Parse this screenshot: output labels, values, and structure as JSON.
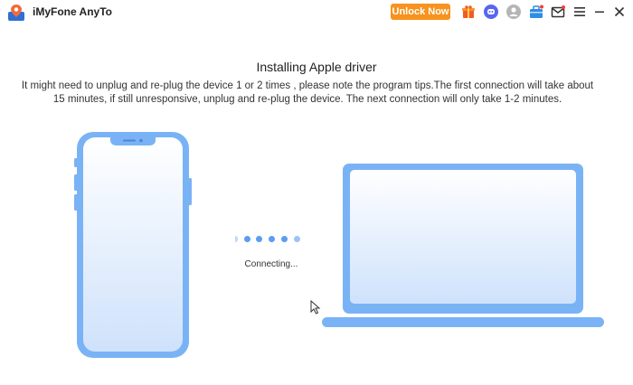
{
  "app": {
    "title": "iMyFone AnyTo",
    "unlock_label": "Unlock Now"
  },
  "titlebar_icons": [
    "gift-icon",
    "discord-icon",
    "user-icon",
    "toolbox-icon",
    "mail-icon",
    "menu-icon",
    "minimize-icon",
    "close-icon"
  ],
  "main": {
    "heading": "Installing Apple driver",
    "description": "It might need to unplug and re-plug the device 1 or 2 times , please note the program tips.The first connection will take about 15 minutes, if still unresponsive, unplug and re-plug the device. The next connection will only take 1-2 minutes.",
    "status": "Connecting..."
  },
  "colors": {
    "accent": "#f7931e",
    "device_blue": "#7ab3f5",
    "dot_blue": "#5b9df0"
  }
}
